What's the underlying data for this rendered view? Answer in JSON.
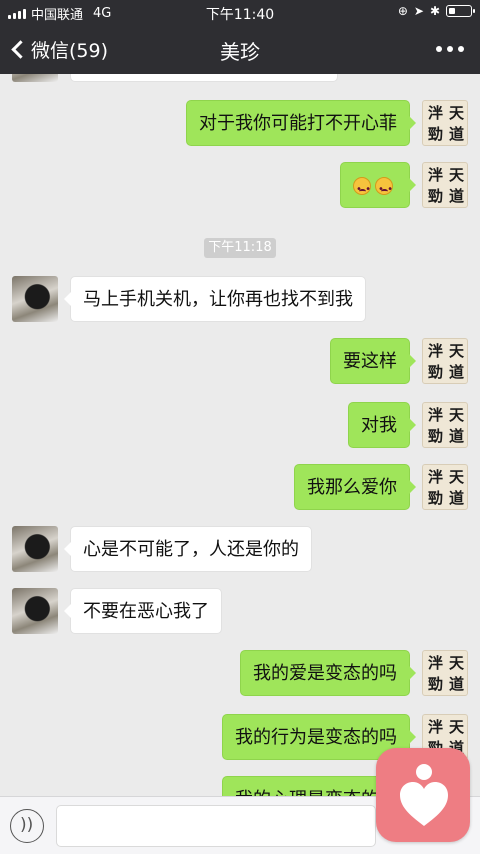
{
  "status_bar": {
    "carrier": "中国联通",
    "network": "4G",
    "time": "下午11:40",
    "battery_level": 0.25
  },
  "nav": {
    "back_label": "微信(59)",
    "title": "美珍"
  },
  "avatar_me": {
    "chars": [
      "泮",
      "天",
      "勁",
      "道"
    ]
  },
  "timestamp": "下午11:18",
  "messages": [
    {
      "from": "me",
      "text": "对于我你可能打不开心菲"
    },
    {
      "from": "me",
      "text": "",
      "emoji": [
        "frowning-face",
        "frowning-face"
      ]
    },
    {
      "from": "her",
      "text": "马上手机关机，让你再也找不到我"
    },
    {
      "from": "me",
      "text": "要这样"
    },
    {
      "from": "me",
      "text": "对我"
    },
    {
      "from": "me",
      "text": "我那么爱你"
    },
    {
      "from": "her",
      "text": "心是不可能了，人还是你的"
    },
    {
      "from": "her",
      "text": "不要在恶心我了"
    },
    {
      "from": "me",
      "text": "我的爱是变态的吗"
    },
    {
      "from": "me",
      "text": "我的行为是变态的吗"
    },
    {
      "from": "me",
      "text": "我的心理是变态的吗"
    }
  ],
  "colors": {
    "header_bg": "#2e2e32",
    "chat_bg": "#ebebeb",
    "my_bubble": "#9fe55a",
    "her_bubble": "#ffffff",
    "float_app": "#ee7d83"
  }
}
